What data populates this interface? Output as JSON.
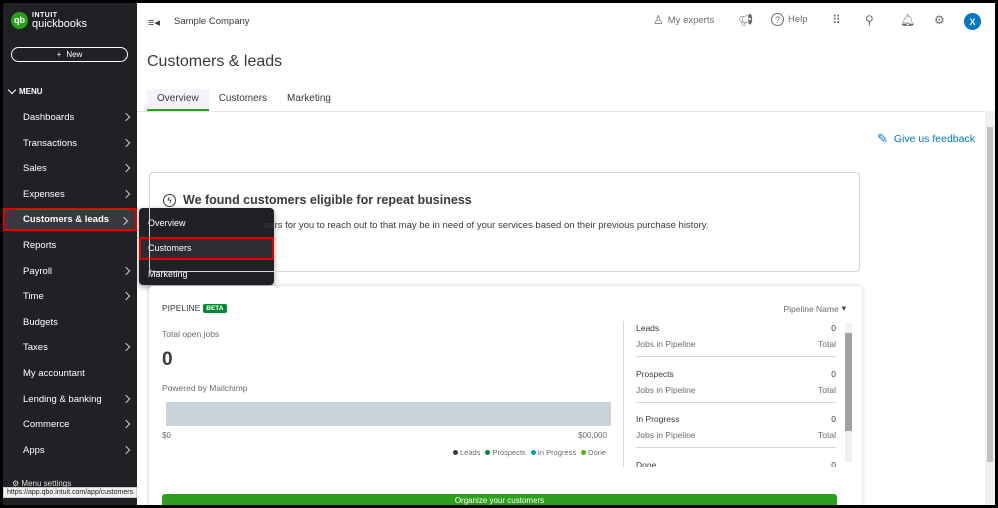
{
  "brand": {
    "line1": "INTUIT",
    "line2": "quickbooks",
    "mark": "qb"
  },
  "sidebar": {
    "new_label": "New",
    "menu_label": "MENU",
    "items": [
      {
        "label": "Dashboards",
        "chevron": true
      },
      {
        "label": "Transactions",
        "chevron": true
      },
      {
        "label": "Sales",
        "chevron": true
      },
      {
        "label": "Expenses",
        "chevron": true
      },
      {
        "label": "Customers & leads",
        "chevron": true,
        "active": true
      },
      {
        "label": "Reports",
        "chevron": false
      },
      {
        "label": "Payroll",
        "chevron": true
      },
      {
        "label": "Time",
        "chevron": true
      },
      {
        "label": "Budgets",
        "chevron": false
      },
      {
        "label": "Taxes",
        "chevron": true
      },
      {
        "label": "My accountant",
        "chevron": false
      },
      {
        "label": "Lending & banking",
        "chevron": true
      },
      {
        "label": "Commerce",
        "chevron": true
      },
      {
        "label": "Apps",
        "chevron": true
      }
    ],
    "menu_settings": "Menu settings"
  },
  "flyout": {
    "items": [
      "Overview",
      "Customers",
      "Marketing"
    ],
    "selected": "Customers"
  },
  "status_url": "https://app.qbo.intuit.com/app/customers",
  "topbar": {
    "company": "Sample Company",
    "my_experts": "My experts",
    "help": "Help",
    "avatar": "X"
  },
  "page": {
    "title": "Customers & leads",
    "tabs": [
      "Overview",
      "Customers",
      "Marketing"
    ],
    "active_tab": "Overview",
    "feedback": "Give us feedback"
  },
  "repeat_card": {
    "title": "We found customers eligible for repeat business",
    "text": "ners for you to reach out to that may be in need of your services based on their previous purchase history."
  },
  "pipeline": {
    "header": "PIPELINE",
    "badge": "BETA",
    "dropdown": "Pipeline Name",
    "total_label": "Total open jobs",
    "total_value": "0",
    "powered_by": "Powered by Mailchimp",
    "axis_min": "$0",
    "axis_max": "$00,000",
    "legend": [
      {
        "label": "Leads",
        "color": "#393a3d"
      },
      {
        "label": "Prospects",
        "color": "#00892e"
      },
      {
        "label": "In Progress",
        "color": "#00a6a4"
      },
      {
        "label": "Done",
        "color": "#53b700"
      }
    ],
    "stages": [
      {
        "name": "Leads",
        "count": "0",
        "sub": "Jobs in Pipeline",
        "sub_right": "Total"
      },
      {
        "name": "Prospects",
        "count": "0",
        "sub": "Jobs in Pipeline",
        "sub_right": "Total"
      },
      {
        "name": "In Progress",
        "count": "0",
        "sub": "Jobs in Pipeline",
        "sub_right": "Total"
      },
      {
        "name": "Done",
        "count": "0",
        "sub": "",
        "sub_right": ""
      }
    ],
    "cta": "Organize your customers"
  },
  "colors": {
    "accent_green": "#2ca01c",
    "link_blue": "#0077c5",
    "highlight_red": "#e00000",
    "sidebar_bg": "#1f2124"
  }
}
